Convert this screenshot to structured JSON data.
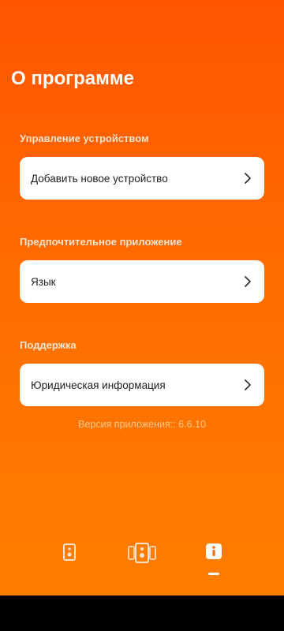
{
  "page": {
    "title": "О программе"
  },
  "sections": [
    {
      "title": "Управление устройством",
      "item_label": "Добавить новое устройство"
    },
    {
      "title": "Предпочтительное приложение",
      "item_label": "Язык"
    },
    {
      "title": "Поддержка",
      "item_label": "Юридическая информация"
    }
  ],
  "version_text": "Версия приложения:: 6.6.10",
  "bottom_nav": [
    {
      "icon": "single-speaker-icon",
      "active": false
    },
    {
      "icon": "multi-speaker-icon",
      "active": false
    },
    {
      "icon": "info-icon",
      "active": true
    }
  ],
  "colors": {
    "accent_top": "#ff5500",
    "accent_bottom": "#ff7e00",
    "card": "#ffffff",
    "section_title": "#ffe3cc",
    "version": "#ffc68a"
  }
}
